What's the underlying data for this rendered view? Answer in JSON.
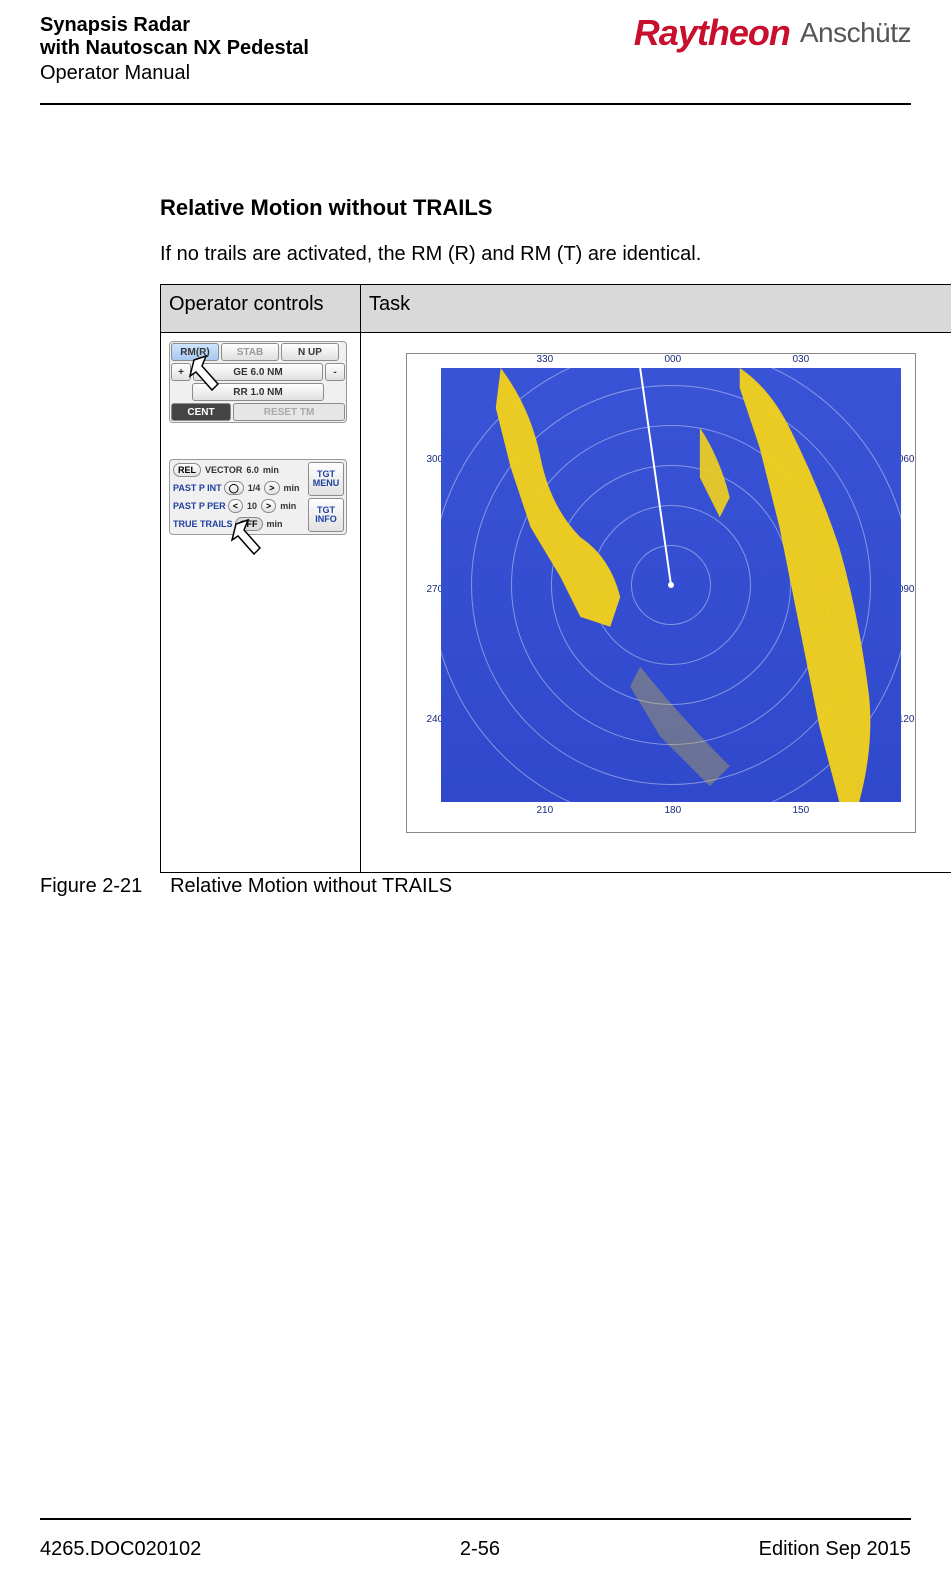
{
  "header": {
    "title_line1": "Synapsis Radar",
    "title_line2": "with Nautoscan NX Pedestal",
    "subtitle": "Operator Manual",
    "brand1": "Raytheon",
    "brand2": "Anschütz"
  },
  "section": {
    "title": "Relative Motion without TRAILS",
    "intro": "If no trails are activated, the RM (R) and RM (T) are identical."
  },
  "table": {
    "col1_header": "Operator controls",
    "col2_header": "Task"
  },
  "panel1": {
    "rm": "RM(R)",
    "stab": "STAB",
    "nup": "N UP",
    "plus": "+",
    "range": "GE 6.0 NM",
    "range_full": "RANGE 6.0 NM",
    "minus": "-",
    "rr": "RR 1.0 NM",
    "cent": "CENT",
    "reset": "RESET TM"
  },
  "panel2": {
    "rel": "REL",
    "vector": "VECTOR",
    "vector_val": "6.0",
    "vector_unit": "min",
    "pastpint": "PAST P INT",
    "pastpint_val": "1/4",
    "pastpint_unit": "min",
    "pastpper": "PAST P PER",
    "pastpper_val": "10",
    "pastpper_unit": "min",
    "true_trails": "TRUE  TRAILS",
    "trails_val": "OFF",
    "trails_unit": "min",
    "tgt_menu": "TGT MENU",
    "tgt_info": "TGT INFO",
    "lt": "<",
    "gt": ">"
  },
  "radar": {
    "bearings_top": [
      "330",
      "000",
      "030"
    ],
    "bearings_right": [
      "060",
      "090",
      "120"
    ],
    "bearings_bottom": [
      "210",
      "180",
      "150"
    ],
    "bearings_left": [
      "300",
      "270",
      "240"
    ]
  },
  "figure": {
    "label": "Figure 2-21",
    "caption": "Relative Motion without TRAILS"
  },
  "footer": {
    "doc": "4265.DOC020102",
    "page": "2-56",
    "edition": "Edition Sep 2015"
  }
}
